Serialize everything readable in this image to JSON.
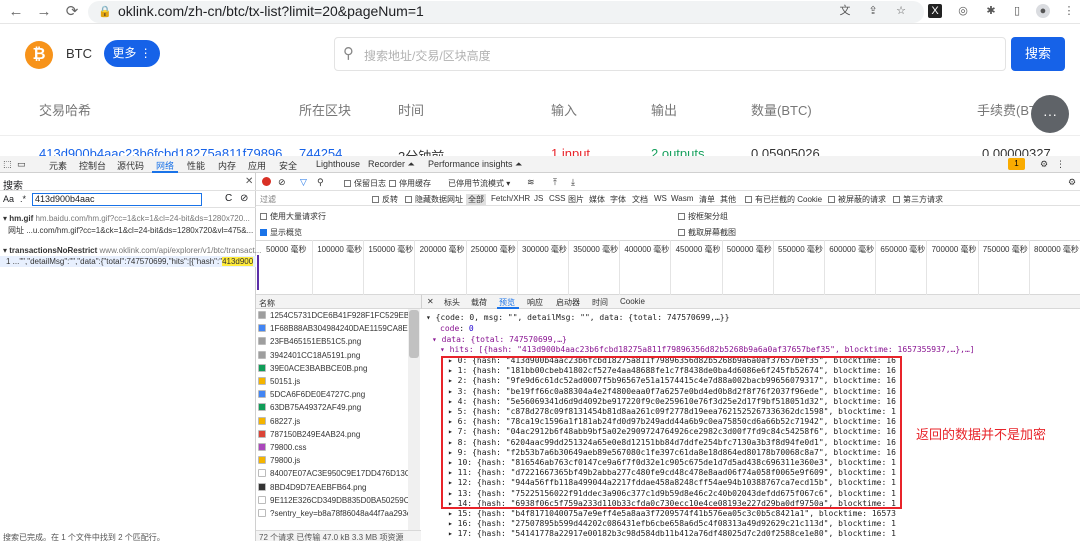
{
  "browser": {
    "url": "oklink.com/zh-cn/btc/tx-list?limit=20&pageNum=1"
  },
  "site": {
    "coin_logo": "₿",
    "coin_name": "BTC",
    "more_button": "更多 ⋮",
    "search_placeholder": "搜索地址/交易/区块高度",
    "search_button": "搜索",
    "table_headers": [
      "交易哈希",
      "所在区块",
      "时间",
      "输入",
      "输出",
      "数量(BTC)",
      "手续费(BTC)"
    ],
    "first_row": {
      "hash": "413d900b4aac23b6fcbd18275a811f79896",
      "block": "744254",
      "time": "2分钟前",
      "input": "1 input",
      "output": "2 outputs",
      "amount": "0.05905026",
      "fee": "0.00000327"
    }
  },
  "devtools": {
    "tabs": [
      "元素",
      "控制台",
      "源代码",
      "网络",
      "性能",
      "内存",
      "应用",
      "安全",
      "Lighthouse",
      "Recorder ⏶",
      "Performance insights ⏶"
    ],
    "active_tab": "网络",
    "badge": "1",
    "search_pane": {
      "title": "搜索",
      "aa": "Aa",
      "regex": ".*",
      "query": "413d900b4aac",
      "result1_file": "hm.gif",
      "result1_url": "hm.baidu.com/hm.gif?cc=1&ck=1&cl=24-bit&ds=1280x720...",
      "result1_line": "网址  ...u.com/hm.gif?cc=1&ck=1&cl=24-bit&ds=1280x720&vl=475&...",
      "result2_file": "transactionsNoRestrict",
      "result2_url": "www.oklink.com/api/explorer/v1/btc/transact...",
      "result2_prefix": "1  ...\"\",\"detailMsg\":\"\",\"data\":{\"total\":747570699,\"hits\":[{\"hash\":\"",
      "result2_hit": "413d900",
      "status": "搜索已完成。在 1 个文件中找到 2 个匹配行。"
    },
    "toolbar": {
      "preserve_log": "保留日志",
      "disable_cache": "停用缓存",
      "throttle": "已停用节流模式 ▾"
    },
    "filter": {
      "placeholder": "过滤",
      "invert": "反转",
      "hide_data_urls": "隐藏数据网址",
      "types": [
        "全部",
        "Fetch/XHR",
        "JS",
        "CSS",
        "图片",
        "媒体",
        "字体",
        "文档",
        "WS",
        "Wasm",
        "清单",
        "其他"
      ],
      "blocked_cookies": "有已拦截的 Cookie",
      "blocked_requests": "被屏蔽的请求",
      "third_party": "第三方请求",
      "big_rows": "使用大量请求行",
      "group_by_frame": "按框架分组",
      "show_overview": "显示概览",
      "capture_screenshots": "截取屏幕截图"
    },
    "timeline_ticks": [
      "50000 毫秒",
      "100000 毫秒",
      "150000 毫秒",
      "200000 毫秒",
      "250000 毫秒",
      "300000 毫秒",
      "350000 毫秒",
      "400000 毫秒",
      "450000 毫秒",
      "500000 毫秒",
      "550000 毫秒",
      "600000 毫秒",
      "650000 毫秒",
      "700000 毫秒",
      "750000 毫秒",
      "800000 毫秒"
    ],
    "requests_header": "名称",
    "requests": [
      {
        "name": "1254C5731DCE6B41F928F1FC529EB505",
        "color": "#9e9e9e"
      },
      {
        "name": "1F68B88AB304984240DAE1159CA8E1D7",
        "color": "#4285f4"
      },
      {
        "name": "23FB465151EB51C5.png",
        "color": "#9e9e9e"
      },
      {
        "name": "3942401CC18A5191.png",
        "color": "#9e9e9e"
      },
      {
        "name": "39E0ACE3BABBCE0B.png",
        "color": "#0f9d58"
      },
      {
        "name": "50151.js",
        "color": "#f4b400"
      },
      {
        "name": "5DCA6F6DE0E4727C.png",
        "color": "#4285f4"
      },
      {
        "name": "63DB75A49372AF49.png",
        "color": "#0f9d58"
      },
      {
        "name": "68227.js",
        "color": "#f4b400"
      },
      {
        "name": "787150B249E4AB24.png",
        "color": "#db4437"
      },
      {
        "name": "79800.css",
        "color": "#ab47bc"
      },
      {
        "name": "79800.js",
        "color": "#f4b400"
      },
      {
        "name": "84007E07AC3E950C9E17DD476D13C6A",
        "color": "#ffffff"
      },
      {
        "name": "8BD4D9D7EAEBFB64.png",
        "color": "#333333"
      },
      {
        "name": "9E112E326CD349DB835D0BA50259CEE",
        "color": "#ffffff"
      },
      {
        "name": "?sentry_key=b8a78f86048a44f7aa293ea",
        "color": "#ffffff"
      }
    ],
    "requests_status": "72 个请求  已传输 47.0 kB  3.3 MB 项资源",
    "preview_tabs": [
      "标头",
      "载荷",
      "预览",
      "响应",
      "启动器",
      "时间",
      "Cookie"
    ],
    "active_preview_tab": "预览",
    "preview": {
      "line0": "▾ {code: 0, msg: \"\", detailMsg: \"\", data: {total: 747570699,…}}",
      "line1_key": "code",
      "line1_val": "0",
      "line2": "▾ data: {total: 747570699,…}",
      "hits_line": "▾ hits: [{hash: \"413d900b4aac23b6fcbd18275a811f79896356d82b5268b9a6a0af37657bef35\", blocktime: 1657355937,…},…]",
      "hits": [
        "▸ 0: {hash: \"413d900b4aac23b6fcbd18275a811f79896356d82b5268b9a6a0af37657bef35\", blocktime: 1657355937,…}",
        "▸ 1: {hash: \"181bb00cbeb41802cf527e4aa48688fe1c7f8438de0ba4d6086e6f245fb52674\", blocktime: 1657355937,…}",
        "▸ 2: {hash: \"9fe9d6c61dc52ad0007f5b96567e51a1574415c4e7d88a002bacb99656079317\", blocktime: 1657355937,…}",
        "▸ 3: {hash: \"be19ff66c0a88304a4e2f4800eaa0f7a6257e0bd4ed0b8d2f8f76f2037f96ede\", blocktime: 1657355937,…}",
        "▸ 4: {hash: \"5e56069341d6d9d4092be917220f9c0e259610e76f3d25e2d17f9bf518051d32\", blocktime: 1657355937,…}",
        "▸ 5: {hash: \"c878d278c09f8131454b81d8aa261c09f2778d19eea7621525267336362dc1598\", blocktime: 1657355937,…}",
        "▸ 6: {hash: \"78ca19c1596a1f181ab24fd0d97b249add44a6b9c0ea75850cd6a66b52c71942\", blocktime: 1657355937,…}",
        "▸ 7: {hash: \"04ac2912b6f48abb9bf5a02e2909724764926ce2982c3d00f7fd9c84c54258f6\", blocktime: 1657355937,…}",
        "▸ 8: {hash: \"6204aac99dd251324a65e0e8d12151bb84d7ddfe254bfc7130a3b3f8d94fe0d1\", blocktime: 1657355937,…}",
        "▸ 9: {hash: \"f2b53b7a6b30649aeb89e567080c1fe397c61da8e18d864ed80178b70068c8a7\", blocktime: 1657355937,…}",
        "▸ 10: {hash: \"816546ab763cf0147ce9a6f7f0d32e1c905c675de1d7d5ad438c696311e360e3\", blocktime: 1657355937,…}",
        "▸ 11: {hash: \"d7221667365bf49b2abba277c480fe9cd48c478e8aad06f74a058f0065e9f609\", blocktime: 1657355937,…}",
        "▸ 12: {hash: \"944a56ffb118a499044a2217fddae458a8248cff54ae94b10388767ca7ecd15b\", blocktime: 1657355937,…}",
        "▸ 13: {hash: \"75225156022f91ddec3a906c377c1d9b59d8e46c2c40b02043defdd675f067c6\", blocktime: 1657355937,…}",
        "▸ 14: {hash: \"6938f06c5f759a233d110b33cfda0c730ecc10e4ce08193e227d29ba0df9750a\", blocktime: 1657355937,…}",
        "▸ 15: {hash: \"b4f8171040075a7e9eff4e5a8aa3f7209574f41b576ea05c3c0b5c8421a1\", blocktime: 1657355937,…}",
        "▸ 16: {hash: \"27507895b599d44202c086431efb6cbe658a6d5c4f08313a49d92629c21c113d\", blocktime: 1657355937,…}",
        "▸ 17: {hash: \"54141778a22917e00182b3c98d584db11b412a76df48025d7c2d0f2588ce1e80\", blocktime: 1657355937,…}"
      ]
    },
    "annotation": "返回的数据并不是加密"
  },
  "colors": {
    "brand_blue": "#1662e8",
    "btc_orange": "#f7931a",
    "annotation_red": "#e8242a"
  }
}
